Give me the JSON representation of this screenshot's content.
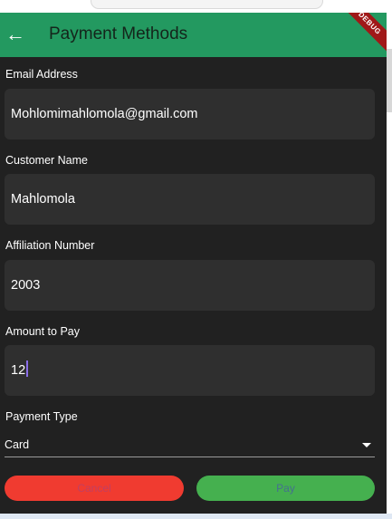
{
  "app_bar": {
    "title": "Payment Methods",
    "debug_label": "DEBUG"
  },
  "form": {
    "email": {
      "label": "Email Address",
      "value": "Mohlomimahlomola@gmail.com"
    },
    "customer": {
      "label": "Customer Name",
      "value": "Mahlomola"
    },
    "affiliation": {
      "label": "Affiliation Number",
      "value": "2003"
    },
    "amount": {
      "label": "Amount to Pay",
      "value": "12"
    },
    "payment_type": {
      "label": "Payment Type",
      "value": "Card"
    }
  },
  "buttons": {
    "cancel": "Cancel",
    "pay": "Pay"
  },
  "colors": {
    "app_bar": "#239960",
    "background": "#212121",
    "cancel": "#f03b30",
    "pay": "#45b04f"
  },
  "icons": {
    "back": "arrow-left",
    "dropdown": "triangle-down"
  }
}
